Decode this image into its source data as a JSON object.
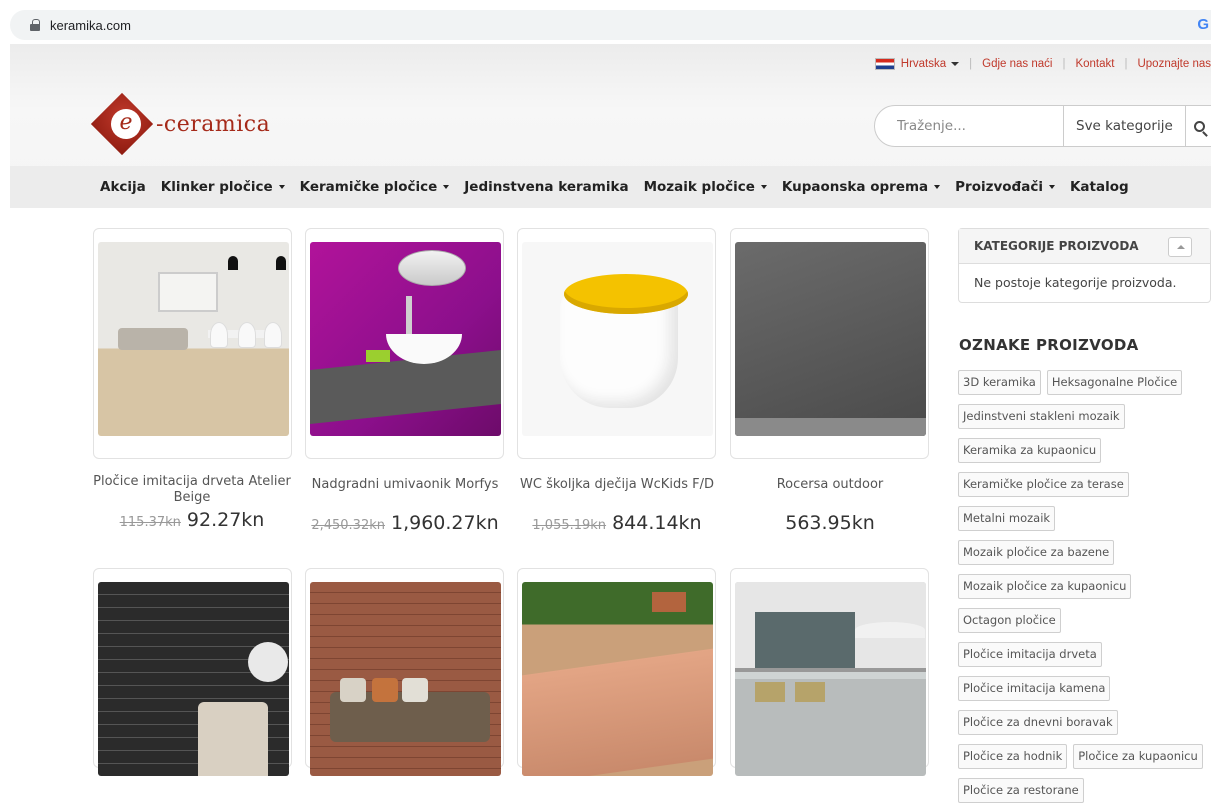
{
  "browser": {
    "url": "keramika.com",
    "account_icon": "G"
  },
  "topbar": {
    "language": "Hrvatska",
    "links": [
      "Gdje nas naći",
      "Kontakt",
      "Upoznajte nas"
    ]
  },
  "logo": {
    "letter": "e",
    "text": "-ceramica"
  },
  "search": {
    "placeholder": "Traženje...",
    "category": "Sve kategorije"
  },
  "nav": [
    {
      "label": "Akcija",
      "dropdown": false
    },
    {
      "label": "Klinker pločice",
      "dropdown": true
    },
    {
      "label": "Keramičke pločice",
      "dropdown": true
    },
    {
      "label": "Jedinstvena keramika",
      "dropdown": false
    },
    {
      "label": "Mozaik pločice",
      "dropdown": true
    },
    {
      "label": "Kupaonska oprema",
      "dropdown": true
    },
    {
      "label": "Proizvođači",
      "dropdown": true
    },
    {
      "label": "Katalog",
      "dropdown": false
    }
  ],
  "products": [
    {
      "name": "Pločice imitacija drveta Atelier Beige",
      "old_price": "115.37kn",
      "price": "92.27kn"
    },
    {
      "name": "Nadgradni umivaonik Morfys",
      "old_price": "2,450.32kn",
      "price": "1,960.27kn"
    },
    {
      "name": "WC školjka dječija WcKids F/D",
      "old_price": "1,055.19kn",
      "price": "844.14kn"
    },
    {
      "name": "Rocersa outdoor",
      "old_price": "",
      "price": "563.95kn"
    }
  ],
  "sidebar": {
    "categories_title": "KATEGORIJE PROIZVODA",
    "categories_empty": "Ne postoje kategorije proizvoda.",
    "tags_title": "OZNAKE PROIZVODA",
    "tags": [
      "3D keramika",
      "Heksagonalne Pločice",
      "Jedinstveni stakleni mozaik",
      "Keramika za kupaonicu",
      "Keramičke pločice za terase",
      "Metalni mozaik",
      "Mozaik pločice za bazene",
      "Mozaik pločice za kupaonicu",
      "Octagon pločice",
      "Pločice imitacija drveta",
      "Pločice imitacija kamena",
      "Pločice za dnevni boravak",
      "Pločice za hodnik",
      "Pločice za kupaonicu",
      "Pločice za restorane"
    ]
  }
}
